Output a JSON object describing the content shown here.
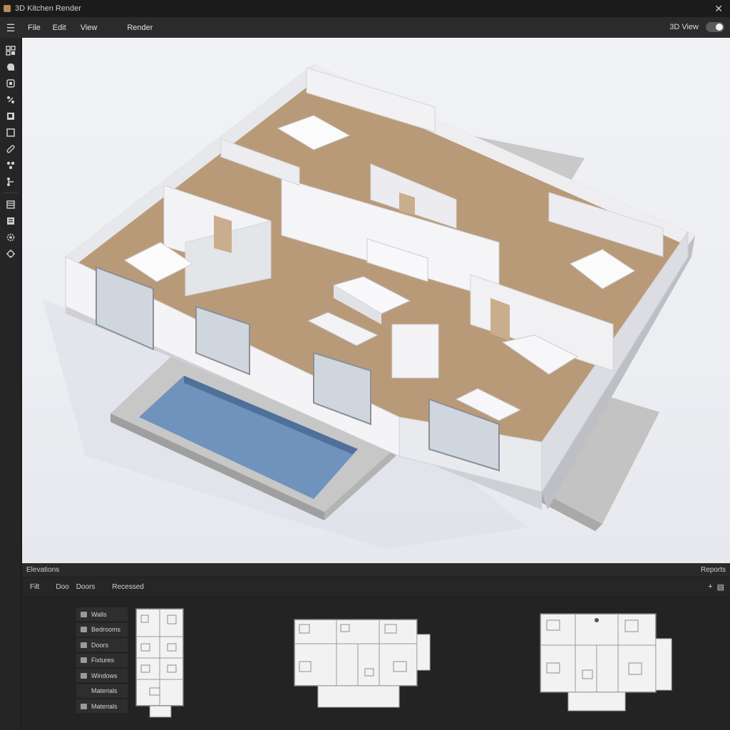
{
  "titlebar": {
    "title": "3D Kitchen Render",
    "close_glyph": "✕"
  },
  "menu": {
    "items": [
      "File",
      "Edit",
      "View",
      "Render"
    ],
    "view_toggle_label": "3D View",
    "view_toggle_on": true
  },
  "tools": [
    "select-tool-icon",
    "shape-tool-icon",
    "object-tool-icon",
    "move-tool-icon",
    "frame-tool-icon",
    "rectangle-tool-icon",
    "measure-tool-icon",
    "group-tool-icon",
    "layers-panel-icon",
    "settings-icon",
    "render-settings-icon"
  ],
  "panel": {
    "left_title": "Elevations",
    "right_title": "Reports",
    "tabs": [
      "Filt",
      "Doo",
      "Doors",
      "Recessed"
    ],
    "tool_icons": [
      "add-icon",
      "save-icon"
    ],
    "layers": [
      {
        "label": "Walls",
        "icon": "wall-icon"
      },
      {
        "label": "Bedrooms",
        "icon": "bedroom-icon"
      },
      {
        "label": "Doors",
        "icon": "door-icon"
      },
      {
        "label": "Fixtures",
        "icon": "fixture-icon"
      },
      {
        "label": "Windows",
        "icon": "window-icon"
      },
      {
        "label": "Materials",
        "icon": ""
      },
      {
        "label": "Materials",
        "icon": "material-icon"
      }
    ]
  },
  "colors": {
    "floor": "#b99a78",
    "wall": "#f4f4f6",
    "wall_shade": "#dcdde2",
    "pool": "#6f93bd",
    "deck": "#bdbdbd"
  }
}
